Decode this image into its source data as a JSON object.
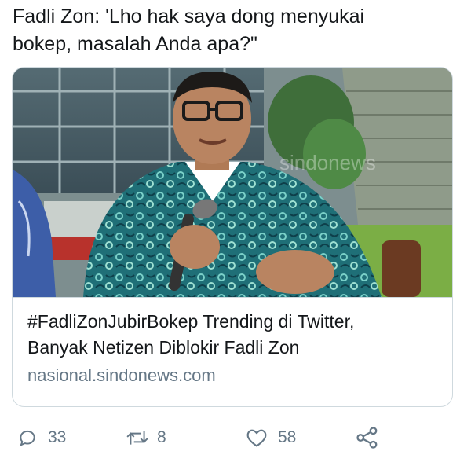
{
  "tweet": {
    "text": "Fadli Zon: 'Lho hak saya dong menyukai\nbokep, masalah Anda apa?\""
  },
  "card": {
    "image": "photo of a man in a blue-green batik shirt speaking into a microphone",
    "watermark": "sindonews",
    "title": "#FadliZonJubirBokep Trending di Twitter,\nBanyak Netizen Diblokir Fadli Zon",
    "domain": "nasional.sindonews.com"
  },
  "actions": {
    "reply": {
      "icon": "reply-icon",
      "count": "33"
    },
    "retweet": {
      "icon": "retweet-icon",
      "count": "8"
    },
    "like": {
      "icon": "heart-icon",
      "count": "58"
    },
    "share": {
      "icon": "share-icon"
    }
  },
  "colors": {
    "text": "#14171a",
    "secondary": "#657786",
    "border": "#cfd9de"
  }
}
